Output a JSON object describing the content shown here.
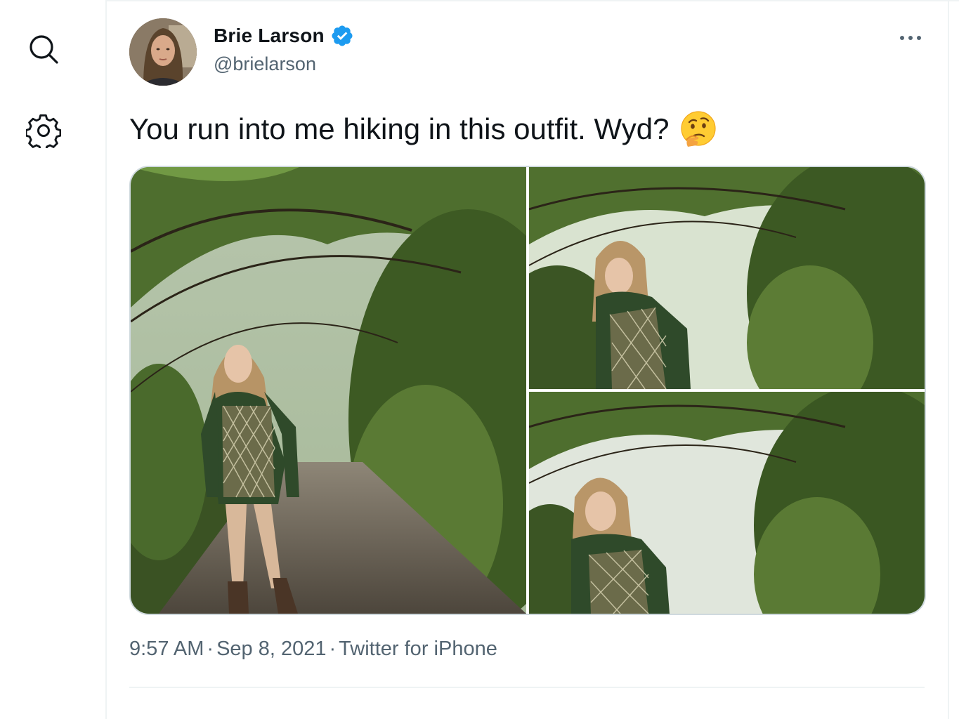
{
  "sidebar": {
    "icons": [
      {
        "name": "search-icon"
      },
      {
        "name": "gear-icon"
      }
    ]
  },
  "tweet": {
    "author": {
      "display_name": "Brie Larson",
      "handle": "@brielarson",
      "verified": true
    },
    "text": "You run into me hiking in this outfit. Wyd?",
    "emoji": "thinking-face",
    "photos": 3,
    "time": "9:57 AM",
    "date": "Sep 8, 2021",
    "source": "Twitter for iPhone",
    "separator": "·"
  },
  "colors": {
    "verified_blue": "#1d9bf0",
    "secondary_text": "#536471",
    "border": "#cfd9de"
  }
}
